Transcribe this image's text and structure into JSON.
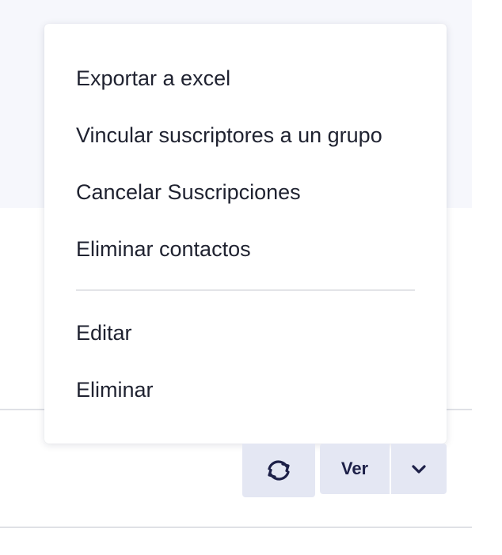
{
  "menu": {
    "items": [
      {
        "label": "Exportar a excel"
      },
      {
        "label": "Vincular suscriptores a un grupo"
      },
      {
        "label": "Cancelar Suscripciones"
      },
      {
        "label": "Eliminar contactos"
      },
      {
        "label": "Editar"
      },
      {
        "label": "Eliminar"
      }
    ]
  },
  "toolbar": {
    "view_label": "Ver",
    "refresh_icon": "refresh-icon",
    "caret_icon": "chevron-down-icon"
  },
  "colors": {
    "page_band": "#f6f7fc",
    "button_bg": "#e4e7f3",
    "icon_color": "#1d2048",
    "text_color": "#1f2230"
  }
}
